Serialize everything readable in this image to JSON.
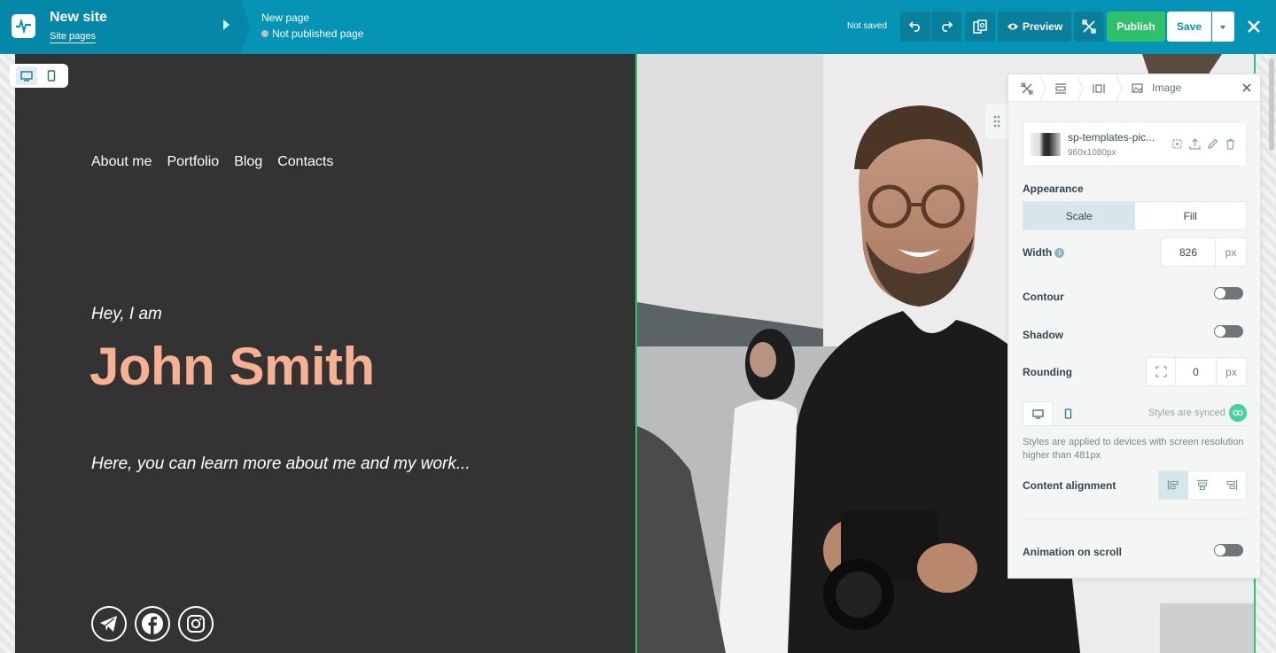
{
  "topbar": {
    "site_title": "New site",
    "site_link": "Site pages",
    "page_title": "New page",
    "page_status": "Not published page",
    "save_state": "Not saved",
    "preview_label": "Preview",
    "publish_label": "Publish",
    "save_label": "Save",
    "colors": {
      "bar": "#0594b5",
      "publish": "#2ec06b"
    }
  },
  "canvas": {
    "nav": [
      "About me",
      "Portfolio",
      "Blog",
      "Contacts"
    ],
    "greeting": "Hey, I am",
    "name": "John Smith",
    "tagline": "Here, you can learn more about me and my work...",
    "socials": [
      "telegram-icon",
      "facebook-icon",
      "instagram-icon"
    ],
    "colors": {
      "background": "#333333",
      "name": "#f8b093"
    }
  },
  "panel": {
    "tab_label": "Image",
    "file": {
      "name": "sp-templates-pic...",
      "size": "960x1080px"
    },
    "appearance_label": "Appearance",
    "appearance_options": [
      "Scale",
      "Fill"
    ],
    "appearance_selected": "Scale",
    "width_label": "Width",
    "width_value": "826",
    "width_unit": "px",
    "contour_label": "Contour",
    "contour_on": false,
    "shadow_label": "Shadow",
    "shadow_on": false,
    "rounding_label": "Rounding",
    "rounding_value": "0",
    "rounding_unit": "px",
    "synced_label": "Styles are synced",
    "note": "Styles are applied to devices with screen resolution higher than 481px",
    "content_alignment_label": "Content alignment",
    "animation_label": "Animation on scroll",
    "animation_on": false
  }
}
